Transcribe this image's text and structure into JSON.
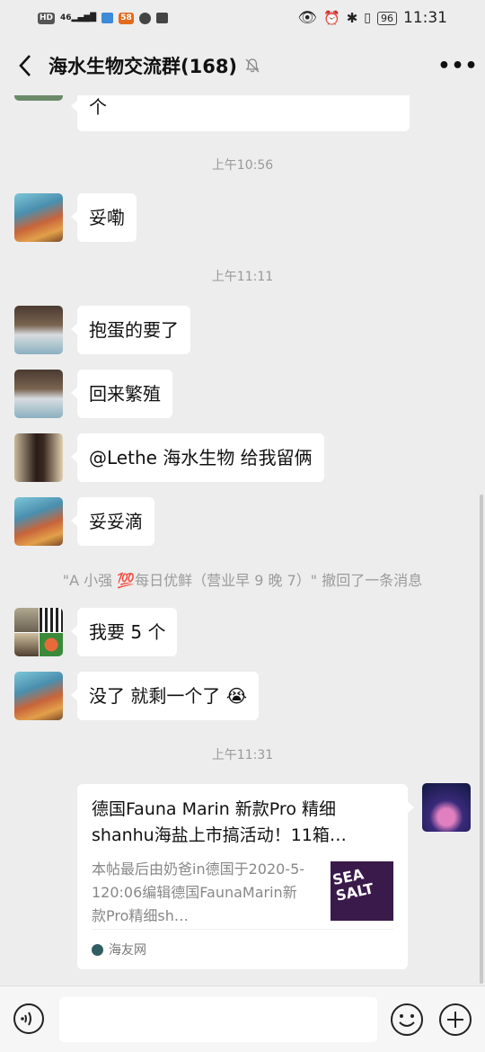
{
  "status_bar": {
    "left_indicators": [
      "HD",
      "46",
      "58"
    ],
    "battery": "96",
    "time": "11:31"
  },
  "header": {
    "title": "海水生物交流群(168)",
    "back_icon": "chevron-left-icon",
    "mute_icon": "bell-muted-icon",
    "more_label": "•••"
  },
  "messages": {
    "partial_text": "个",
    "t1": "上午10:56",
    "m1": "妥嘞",
    "t2": "上午11:11",
    "m2": "抱蛋的要了",
    "m3": "回来繁殖",
    "m4": "@Lethe 海水生物  给我留俩",
    "m5": "妥妥滴",
    "recall": "\"A 小强 💯每日优鲜（营业早 9 晚 7）\" 撤回了一条消息",
    "m6": "我要 5 个",
    "m7": "没了  就剩一个了 😭",
    "t3": "上午11:31"
  },
  "link_card": {
    "title": "德国Fauna Marin 新款Pro 精细shanhu海盐上市搞活动！11箱…",
    "description": "本帖最后由奶爸in德国于2020-5-120:06编辑德国FaunaMarin新款Pro精细sh…",
    "source": "海友网",
    "thumb_text": "SEA SALT"
  },
  "colors": {
    "background": "#ededed",
    "bubble": "#ffffff",
    "time_text": "#999999"
  }
}
